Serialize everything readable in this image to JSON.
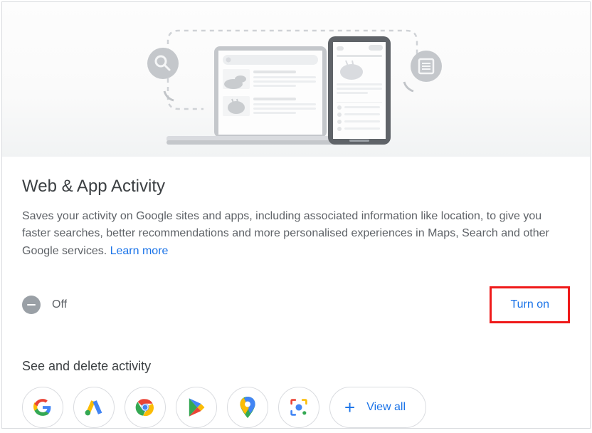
{
  "title": "Web & App Activity",
  "description": "Saves your activity on Google sites and apps, including associated information like location, to give you faster searches, better recommendations and more personalised experiences in Maps, Search and other Google services. ",
  "learn_more": "Learn more",
  "status": {
    "label": "Off",
    "turn_on": "Turn on"
  },
  "section2": {
    "title": "See and delete activity",
    "view_all": "View all"
  },
  "icons": [
    "google",
    "ads",
    "chrome",
    "play",
    "maps",
    "lens"
  ]
}
